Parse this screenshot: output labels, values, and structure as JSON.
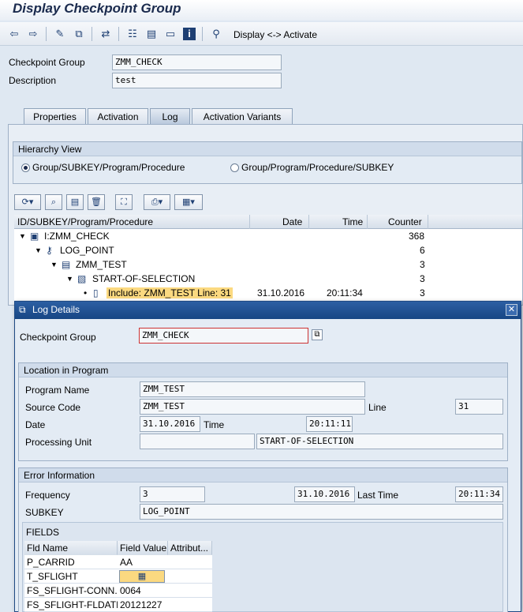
{
  "window": {
    "title": "Display Checkpoint Group"
  },
  "toolbar": {
    "display_activate_label": "Display <-> Activate"
  },
  "header": {
    "checkpoint_group_label": "Checkpoint Group",
    "checkpoint_group_value": "ZMM_CHECK",
    "description_label": "Description",
    "description_value": "test"
  },
  "tabs": [
    {
      "label": "Properties"
    },
    {
      "label": "Activation"
    },
    {
      "label": "Log"
    },
    {
      "label": "Activation Variants"
    }
  ],
  "hierarchy": {
    "title": "Hierarchy View",
    "option1": "Group/SUBKEY/Program/Procedure",
    "option2": "Group/Program/Procedure/SUBKEY"
  },
  "tree": {
    "columns": [
      "ID/SUBKEY/Program/Procedure",
      "Date",
      "Time",
      "Counter"
    ],
    "rows": [
      {
        "label": "I:ZMM_CHECK",
        "date": "",
        "time": "",
        "counter": "368"
      },
      {
        "label": "LOG_POINT",
        "date": "",
        "time": "",
        "counter": "6"
      },
      {
        "label": "ZMM_TEST",
        "date": "",
        "time": "",
        "counter": "3"
      },
      {
        "label": "START-OF-SELECTION",
        "date": "",
        "time": "",
        "counter": "3"
      },
      {
        "label": "Include: ZMM_TEST  Line: 31",
        "date": "31.10.2016",
        "time": "20:11:34",
        "counter": "3"
      }
    ]
  },
  "popup": {
    "title": "Log Details",
    "checkpoint_group_label": "Checkpoint Group",
    "checkpoint_group_value": "ZMM_CHECK",
    "location": {
      "title": "Location in Program",
      "program_name_label": "Program Name",
      "program_name_value": "ZMM_TEST",
      "source_code_label": "Source Code",
      "source_code_value": "ZMM_TEST",
      "line_label": "Line",
      "line_value": "31",
      "date_label": "Date",
      "date_value": "31.10.2016",
      "time_label": "Time",
      "time_value": "20:11:11",
      "processing_unit_label": "Processing Unit",
      "processing_unit_value": "",
      "processing_unit_text": "START-OF-SELECTION"
    },
    "error": {
      "title": "Error Information",
      "frequency_label": "Frequency",
      "frequency_value": "3",
      "first_date_value": "31.10.2016",
      "last_time_label": "Last Time",
      "last_time_value": "20:11:34",
      "subkey_label": "SUBKEY",
      "subkey_value": "LOG_POINT",
      "fields_title": "FIELDS",
      "fields_columns": [
        "Fld Name",
        "Field Value",
        "Attribut..."
      ],
      "fields_rows": [
        {
          "name": "P_CARRID",
          "value": "AA"
        },
        {
          "name": "T_SFLIGHT",
          "value": ""
        },
        {
          "name": "FS_SFLIGHT-CONN...",
          "value": "0064"
        },
        {
          "name": "FS_SFLIGHT-FLDATE",
          "value": "20121227"
        }
      ]
    }
  }
}
